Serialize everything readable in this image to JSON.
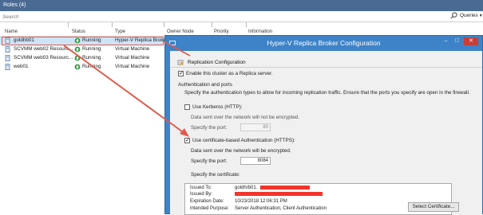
{
  "window": {
    "title": "Roles (4)"
  },
  "search": {
    "placeholder": "Search",
    "queries_label": "Queries"
  },
  "columns": {
    "name": "Name",
    "status": "Status",
    "type": "Type",
    "owner_node": "Owner Node",
    "priority": "Priority",
    "information": "Information"
  },
  "roles": [
    {
      "name": "goldhb01",
      "status": "Running",
      "type": "Hyper-V Replica Broker",
      "selected": true
    },
    {
      "name": "SCVMM web02 Resourc...",
      "status": "Running",
      "type": "Virtual Machine",
      "selected": false
    },
    {
      "name": "SCVMM web03 Resourc...",
      "status": "Running",
      "type": "Virtual Machine",
      "selected": false
    },
    {
      "name": "web01",
      "status": "Running",
      "type": "Virtual Machine",
      "selected": false
    }
  ],
  "dialog": {
    "title": "Hyper-V Replica Broker Configuration",
    "section": "Replication Configuration",
    "enable_label": "Enable this cluster as a Replica server.",
    "auth_group": "Authentication and ports",
    "auth_desc": "Specify the authentication types to allow for incoming replication traffic. Ensure that the ports you specify are open in the firewall.",
    "kerberos_label": "Use Kerberos (HTTP):",
    "kerberos_note": "Data sent over the network will not be encrypted.",
    "kerberos_port_label": "Specify the port:",
    "kerberos_port": "80",
    "cert_label": "Use certificate-based Authentication (HTTPS):",
    "cert_note": "Data sent over the network will be encrypted.",
    "cert_port_label": "Specify the port:",
    "cert_port": "8084",
    "specify_cert": "Specify the certificate:",
    "cert": {
      "issued_to_label": "Issued To:",
      "issued_to": "goldhrb01.",
      "issued_by_label": "Issued By:",
      "expiration_label": "Expiration Date:",
      "expiration": "10/23/2018 12:06:31 PM",
      "purpose_label": "Intended Purpose:",
      "purpose": "Server Authentication, Client Authentication"
    },
    "select_cert_button": "Select Certificate..."
  },
  "colors": {
    "titlebar": "#4a6a93",
    "dialog_frame": "#3e83c7",
    "close_button": "#c5403b",
    "selection": "#cfe3f7",
    "annotation": "#e0594c",
    "redaction": "#f2342a",
    "status_ok": "#2e9a3a"
  }
}
